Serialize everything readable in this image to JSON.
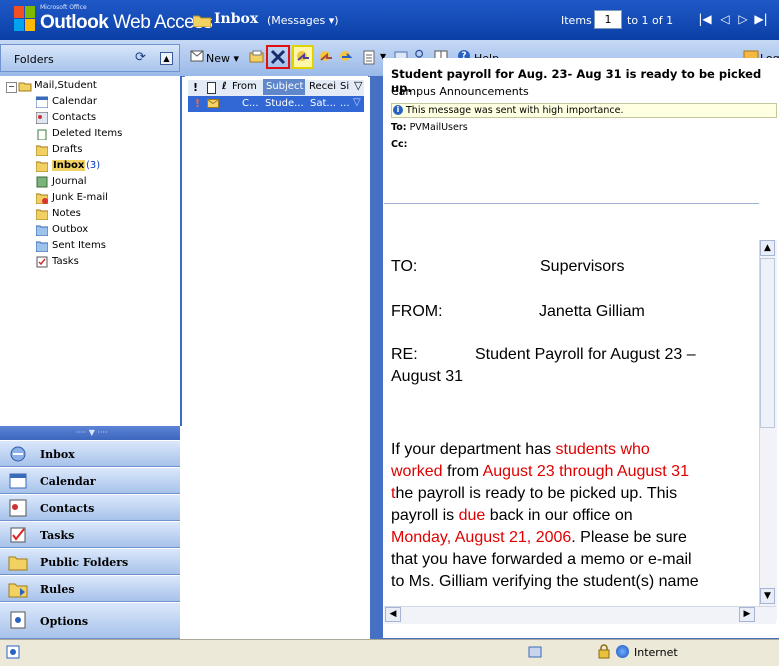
{
  "header": {
    "brand_small": "Microsoft Office",
    "brand_bold": "Outlook",
    "brand_rest": " Web Access",
    "folder_title": "Inbox",
    "folder_sub": "(Messages ▾)",
    "items_label": "Items",
    "items_value": "1",
    "items_range": "to 1 of 1"
  },
  "toolbar": {
    "folders_label": "Folders",
    "new_label": "New ▾",
    "help_label": "Help",
    "logoff_label": "Log Of"
  },
  "tree": {
    "root": "Mail,Student",
    "items": [
      {
        "label": "Calendar"
      },
      {
        "label": "Contacts"
      },
      {
        "label": "Deleted Items"
      },
      {
        "label": "Drafts"
      },
      {
        "label": "Inbox",
        "count": "(3)"
      },
      {
        "label": "Journal"
      },
      {
        "label": "Junk E-mail"
      },
      {
        "label": "Notes"
      },
      {
        "label": "Outbox"
      },
      {
        "label": "Sent Items"
      },
      {
        "label": "Tasks"
      }
    ]
  },
  "nav": {
    "items": [
      "Inbox",
      "Calendar",
      "Contacts",
      "Tasks",
      "Public Folders",
      "Rules",
      "Options"
    ]
  },
  "message_list": {
    "columns": [
      "!",
      "From",
      "Subject",
      "Recei",
      "Si"
    ],
    "row": {
      "from": "C...",
      "subject": "Stude...",
      "received": "Sat...",
      "size": "..."
    }
  },
  "message": {
    "subject": "Student payroll for Aug. 23- Aug 31 is ready to be picked up.",
    "sender": "Campus Announcements",
    "importance_text": "This message was sent with high importance.",
    "to_label": "To:",
    "to_value": "PVMailUsers",
    "cc_label": "Cc:",
    "body": {
      "to_label": "TO:",
      "to_value": "Supervisors",
      "from_label": "FROM:",
      "from_value": "Janetta Gilliam",
      "re_label": "RE:",
      "re_value": "Student Payroll for August 23 –",
      "re_value2": "August 31",
      "p1a": "If your department has ",
      "p1b": "students who",
      "p2a": "worked",
      "p2b": " from ",
      "p2c": "August 23 through August 31",
      "p3a": "t",
      "p3b": "he payroll is ready to be picked up. This",
      "p4a": "payroll is ",
      "p4b": "due",
      "p4c": " back in our office on",
      "p5a": "Monday, August 21, 2006",
      "p5b": ". Please be sure",
      "p6": "that you have forwarded a memo or e-mail",
      "p7": "to Ms. Gilliam verifying the student(s) name"
    }
  },
  "status": {
    "zone": "Internet"
  },
  "colors": {
    "header_blue": "#0b3fa6",
    "nav_blue": "#4670c4",
    "selection": "#3168d5",
    "highlight_red": "#e00000"
  }
}
